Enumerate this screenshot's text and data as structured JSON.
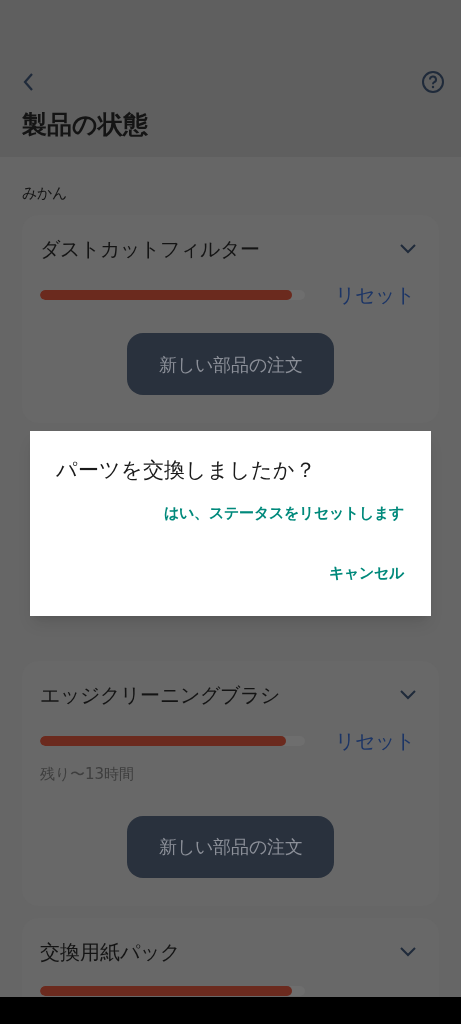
{
  "header": {
    "title": "製品の状態"
  },
  "device_name": "みかん",
  "parts": [
    {
      "name": "ダストカットフィルター",
      "level": 0.95,
      "reset_label": "リセット",
      "order_button": "新しい部品の注文"
    },
    {
      "name": "エッジクリーニングブラシ",
      "level": 0.93,
      "reset_label": "リセット",
      "remaining": "残り〜13時間",
      "order_button": "新しい部品の注文"
    },
    {
      "name": "交換用紙パック",
      "level": 0.95
    }
  ],
  "dialog": {
    "title": "パーツを交換しましたか？",
    "actions": [
      "はい、ステータスをリセットします",
      "キャンセル"
    ]
  }
}
